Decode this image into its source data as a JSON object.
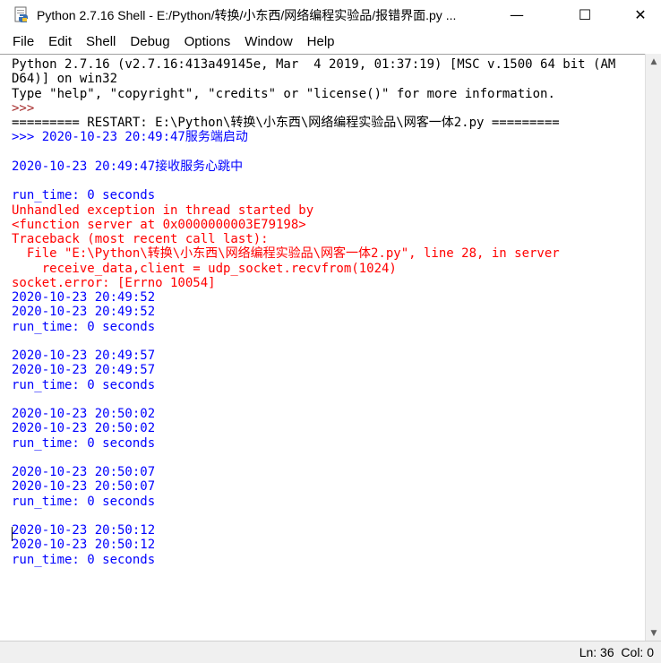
{
  "window": {
    "title": "Python 2.7.16 Shell - E:/Python/转换/小东西/网络编程实验品/报错界面.py ...",
    "minimize": "—",
    "maximize": "☐",
    "close": "✕"
  },
  "menu": [
    "File",
    "Edit",
    "Shell",
    "Debug",
    "Options",
    "Window",
    "Help"
  ],
  "shell_lines": [
    {
      "text": "Python 2.7.16 (v2.7.16:413a49145e, Mar  4 2019, 01:37:19) [MSC v.1500 64 bit (AM",
      "style": "normal"
    },
    {
      "text": "D64)] on win32",
      "style": "normal"
    },
    {
      "text": "Type \"help\", \"copyright\", \"credits\" or \"license()\" for more information.",
      "style": "normal"
    },
    {
      "text": ">>> ",
      "style": "prompt"
    },
    {
      "text": "========= RESTART: E:\\Python\\转换\\小东西\\网络编程实验品\\网客一体2.py =========",
      "style": "restart"
    },
    {
      "text": ">>> 2020-10-23 20:49:47服务端启动",
      "style": "stdout"
    },
    {
      "text": "",
      "style": "stdout"
    },
    {
      "text": "2020-10-23 20:49:47接收服务心跳中",
      "style": "stdout"
    },
    {
      "text": "",
      "style": "stdout"
    },
    {
      "text": "run_time: 0 seconds",
      "style": "stdout"
    },
    {
      "text": "Unhandled exception in thread started by",
      "style": "stderr"
    },
    {
      "text": "<function server at 0x0000000003E79198>",
      "style": "stderr"
    },
    {
      "text": "Traceback (most recent call last):",
      "style": "stderr"
    },
    {
      "text": "  File \"E:\\Python\\转换\\小东西\\网络编程实验品\\网客一体2.py\", line 28, in server",
      "style": "stderr"
    },
    {
      "text": "    receive_data,client = udp_socket.recvfrom(1024)",
      "style": "stderr"
    },
    {
      "text": "socket.error: [Errno 10054]",
      "style": "stderr"
    },
    {
      "text": "2020-10-23 20:49:52",
      "style": "stdout"
    },
    {
      "text": "2020-10-23 20:49:52",
      "style": "stdout"
    },
    {
      "text": "run_time: 0 seconds",
      "style": "stdout"
    },
    {
      "text": "",
      "style": "stdout"
    },
    {
      "text": "2020-10-23 20:49:57",
      "style": "stdout"
    },
    {
      "text": "2020-10-23 20:49:57",
      "style": "stdout"
    },
    {
      "text": "run_time: 0 seconds",
      "style": "stdout"
    },
    {
      "text": "",
      "style": "stdout"
    },
    {
      "text": "2020-10-23 20:50:02",
      "style": "stdout"
    },
    {
      "text": "2020-10-23 20:50:02",
      "style": "stdout"
    },
    {
      "text": "run_time: 0 seconds",
      "style": "stdout"
    },
    {
      "text": "",
      "style": "stdout"
    },
    {
      "text": "2020-10-23 20:50:07",
      "style": "stdout"
    },
    {
      "text": "2020-10-23 20:50:07",
      "style": "stdout"
    },
    {
      "text": "run_time: 0 seconds",
      "style": "stdout"
    },
    {
      "text": "",
      "style": "stdout"
    },
    {
      "text": "2020-10-23 20:50:12",
      "style": "stdout"
    },
    {
      "text": "2020-10-23 20:50:12",
      "style": "stdout"
    },
    {
      "text": "run_time: 0 seconds",
      "style": "stdout"
    }
  ],
  "status": {
    "line": "Ln: 36",
    "col": "Col: 0"
  },
  "colors": {
    "stdout": "#0000ff",
    "stderr": "#ff0000",
    "normal": "#000000"
  },
  "icons": {
    "app": "python-idle-icon",
    "scroll_up": "▲",
    "scroll_down": "▼"
  }
}
